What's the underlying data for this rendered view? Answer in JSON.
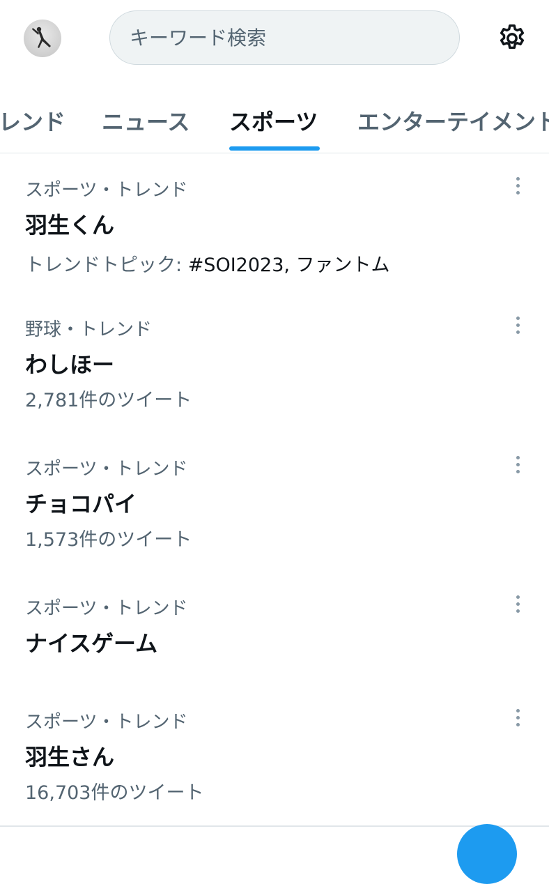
{
  "header": {
    "search_placeholder": "キーワード検索",
    "settings_icon": "gear-icon",
    "avatar_icon": "avatar-icon"
  },
  "tabs": [
    {
      "label": "トレンド",
      "active": false
    },
    {
      "label": "ニュース",
      "active": false
    },
    {
      "label": "スポーツ",
      "active": true
    },
    {
      "label": "エンターテイメント",
      "active": false
    }
  ],
  "trends": [
    {
      "category": "スポーツ・トレンド",
      "name": "羽生くん",
      "topics_label": "トレンドトピック: ",
      "topics": "#SOI2023, ファントム"
    },
    {
      "category": "野球・トレンド",
      "name": "わしほー",
      "tweets": "2,781件のツイート"
    },
    {
      "category": "スポーツ・トレンド",
      "name": "チョコパイ",
      "tweets": "1,573件のツイート"
    },
    {
      "category": "スポーツ・トレンド",
      "name": "ナイスゲーム"
    },
    {
      "category": "スポーツ・トレンド",
      "name": "羽生さん",
      "tweets": "16,703件のツイート"
    }
  ],
  "colors": {
    "accent": "#1d9bf0",
    "secondary_text": "#536471",
    "primary_text": "#0f1419"
  }
}
